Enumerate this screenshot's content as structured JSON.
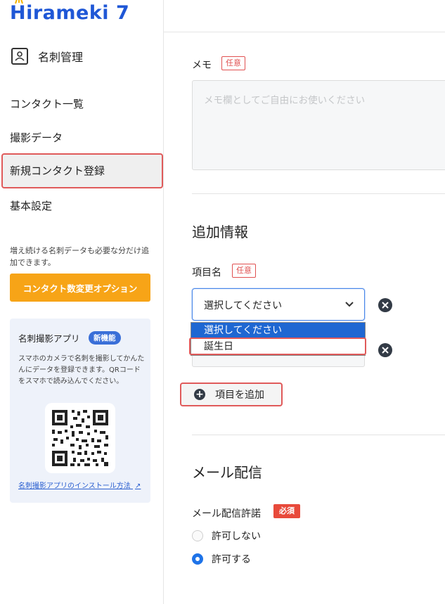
{
  "brand": {
    "logo_text": "Hirameki 7",
    "color": "#1f57d6"
  },
  "sidebar": {
    "section_title": "名刺管理",
    "items": [
      {
        "label": "コンタクト一覧"
      },
      {
        "label": "撮影データ"
      },
      {
        "label": "新規コンタクト登録",
        "active": true
      },
      {
        "label": "基本設定"
      }
    ],
    "note": "増え続ける名刺データも必要な分だけ追加できます。",
    "option_button": "コンタクト数変更オプション",
    "app_card": {
      "title": "名刺撮影アプリ",
      "badge": "新機能",
      "description": "スマホのカメラで名刺を撮影してかんたんにデータを登録できます。QRコードをスマホで読み込んでください。",
      "link": "名刺撮影アプリのインストール方法"
    }
  },
  "memo": {
    "label": "メモ",
    "badge": "任意",
    "placeholder": "メモ欄としてご自由にお使いください"
  },
  "additional": {
    "heading": "追加情報",
    "item_label": "項目名",
    "item_badge": "任意",
    "select_value": "選択してください",
    "dropdown_options": [
      "選択してください",
      "誕生日"
    ],
    "second_field_placeholder": "選択してください",
    "add_button": "項目を追加"
  },
  "mail": {
    "heading": "メール配信",
    "permission_label": "メール配信許諾",
    "required_badge": "必須",
    "options": [
      {
        "label": "許可しない",
        "checked": false
      },
      {
        "label": "許可する",
        "checked": true
      }
    ]
  },
  "colors": {
    "accent": "#1e67d2",
    "orange": "#f7a417",
    "highlight": "#e05a5a",
    "required": "#e84a3b"
  }
}
